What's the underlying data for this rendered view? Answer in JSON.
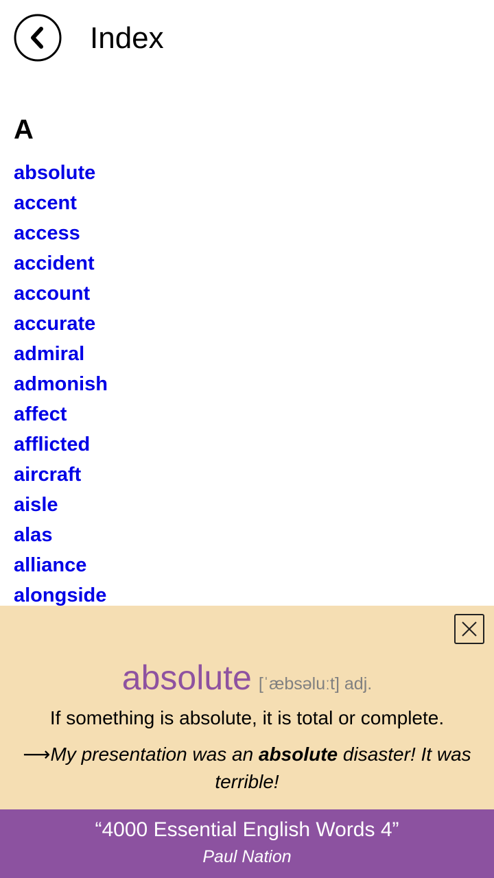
{
  "header": {
    "title": "Index",
    "back_icon": "chevron-left-icon"
  },
  "index": {
    "section_letter": "A",
    "words": [
      "absolute",
      "accent",
      "access",
      "accident",
      "account",
      "accurate",
      "admiral",
      "admonish",
      "affect",
      "afflicted",
      "aircraft",
      "aisle",
      "alas",
      "alliance",
      "alongside"
    ]
  },
  "popup": {
    "close_icon": "close-icon",
    "word": "absolute",
    "pronunciation": "[ˈæbsəluːt] adj.",
    "definition": "If something is absolute, it is total or complete.",
    "example_prefix": "⟶My presentation was an ",
    "example_keyword": "absolute",
    "example_suffix": " disaster! It was terrible!"
  },
  "footer": {
    "title": "“4000 Essential English Words 4”",
    "author": "Paul Nation"
  },
  "colors": {
    "link": "#0000e6",
    "popup_background": "#f5deb3",
    "accent_purple": "#8c52a0",
    "pronunciation_gray": "#808080"
  }
}
